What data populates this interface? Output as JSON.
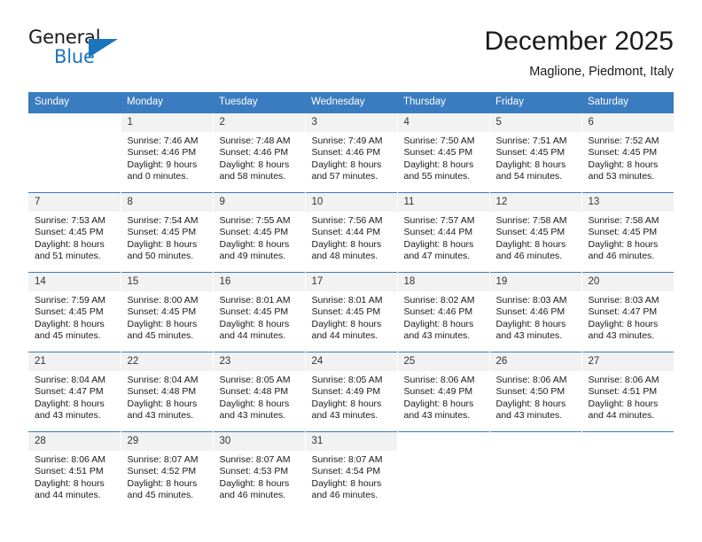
{
  "brand": {
    "name_top": "General",
    "name_bottom": "Blue",
    "accent_color": "#1b75bb"
  },
  "header": {
    "title": "December 2025",
    "subtitle": "Maglione, Piedmont, Italy"
  },
  "theme": {
    "header_row_bg": "#3a7cc0",
    "daynum_bg": "#f2f2f2",
    "page_bg": "#ffffff"
  },
  "columns": [
    "Sunday",
    "Monday",
    "Tuesday",
    "Wednesday",
    "Thursday",
    "Friday",
    "Saturday"
  ],
  "weeks": [
    [
      {
        "day": "",
        "empty": true,
        "sunrise": "",
        "sunset": "",
        "daylight_line1": "",
        "daylight_line2": ""
      },
      {
        "day": "1",
        "sunrise": "Sunrise: 7:46 AM",
        "sunset": "Sunset: 4:46 PM",
        "daylight_line1": "Daylight: 9 hours",
        "daylight_line2": "and 0 minutes."
      },
      {
        "day": "2",
        "sunrise": "Sunrise: 7:48 AM",
        "sunset": "Sunset: 4:46 PM",
        "daylight_line1": "Daylight: 8 hours",
        "daylight_line2": "and 58 minutes."
      },
      {
        "day": "3",
        "sunrise": "Sunrise: 7:49 AM",
        "sunset": "Sunset: 4:46 PM",
        "daylight_line1": "Daylight: 8 hours",
        "daylight_line2": "and 57 minutes."
      },
      {
        "day": "4",
        "sunrise": "Sunrise: 7:50 AM",
        "sunset": "Sunset: 4:45 PM",
        "daylight_line1": "Daylight: 8 hours",
        "daylight_line2": "and 55 minutes."
      },
      {
        "day": "5",
        "sunrise": "Sunrise: 7:51 AM",
        "sunset": "Sunset: 4:45 PM",
        "daylight_line1": "Daylight: 8 hours",
        "daylight_line2": "and 54 minutes."
      },
      {
        "day": "6",
        "sunrise": "Sunrise: 7:52 AM",
        "sunset": "Sunset: 4:45 PM",
        "daylight_line1": "Daylight: 8 hours",
        "daylight_line2": "and 53 minutes."
      }
    ],
    [
      {
        "day": "7",
        "sunrise": "Sunrise: 7:53 AM",
        "sunset": "Sunset: 4:45 PM",
        "daylight_line1": "Daylight: 8 hours",
        "daylight_line2": "and 51 minutes."
      },
      {
        "day": "8",
        "sunrise": "Sunrise: 7:54 AM",
        "sunset": "Sunset: 4:45 PM",
        "daylight_line1": "Daylight: 8 hours",
        "daylight_line2": "and 50 minutes."
      },
      {
        "day": "9",
        "sunrise": "Sunrise: 7:55 AM",
        "sunset": "Sunset: 4:45 PM",
        "daylight_line1": "Daylight: 8 hours",
        "daylight_line2": "and 49 minutes."
      },
      {
        "day": "10",
        "sunrise": "Sunrise: 7:56 AM",
        "sunset": "Sunset: 4:44 PM",
        "daylight_line1": "Daylight: 8 hours",
        "daylight_line2": "and 48 minutes."
      },
      {
        "day": "11",
        "sunrise": "Sunrise: 7:57 AM",
        "sunset": "Sunset: 4:44 PM",
        "daylight_line1": "Daylight: 8 hours",
        "daylight_line2": "and 47 minutes."
      },
      {
        "day": "12",
        "sunrise": "Sunrise: 7:58 AM",
        "sunset": "Sunset: 4:45 PM",
        "daylight_line1": "Daylight: 8 hours",
        "daylight_line2": "and 46 minutes."
      },
      {
        "day": "13",
        "sunrise": "Sunrise: 7:58 AM",
        "sunset": "Sunset: 4:45 PM",
        "daylight_line1": "Daylight: 8 hours",
        "daylight_line2": "and 46 minutes."
      }
    ],
    [
      {
        "day": "14",
        "sunrise": "Sunrise: 7:59 AM",
        "sunset": "Sunset: 4:45 PM",
        "daylight_line1": "Daylight: 8 hours",
        "daylight_line2": "and 45 minutes."
      },
      {
        "day": "15",
        "sunrise": "Sunrise: 8:00 AM",
        "sunset": "Sunset: 4:45 PM",
        "daylight_line1": "Daylight: 8 hours",
        "daylight_line2": "and 45 minutes."
      },
      {
        "day": "16",
        "sunrise": "Sunrise: 8:01 AM",
        "sunset": "Sunset: 4:45 PM",
        "daylight_line1": "Daylight: 8 hours",
        "daylight_line2": "and 44 minutes."
      },
      {
        "day": "17",
        "sunrise": "Sunrise: 8:01 AM",
        "sunset": "Sunset: 4:45 PM",
        "daylight_line1": "Daylight: 8 hours",
        "daylight_line2": "and 44 minutes."
      },
      {
        "day": "18",
        "sunrise": "Sunrise: 8:02 AM",
        "sunset": "Sunset: 4:46 PM",
        "daylight_line1": "Daylight: 8 hours",
        "daylight_line2": "and 43 minutes."
      },
      {
        "day": "19",
        "sunrise": "Sunrise: 8:03 AM",
        "sunset": "Sunset: 4:46 PM",
        "daylight_line1": "Daylight: 8 hours",
        "daylight_line2": "and 43 minutes."
      },
      {
        "day": "20",
        "sunrise": "Sunrise: 8:03 AM",
        "sunset": "Sunset: 4:47 PM",
        "daylight_line1": "Daylight: 8 hours",
        "daylight_line2": "and 43 minutes."
      }
    ],
    [
      {
        "day": "21",
        "sunrise": "Sunrise: 8:04 AM",
        "sunset": "Sunset: 4:47 PM",
        "daylight_line1": "Daylight: 8 hours",
        "daylight_line2": "and 43 minutes."
      },
      {
        "day": "22",
        "sunrise": "Sunrise: 8:04 AM",
        "sunset": "Sunset: 4:48 PM",
        "daylight_line1": "Daylight: 8 hours",
        "daylight_line2": "and 43 minutes."
      },
      {
        "day": "23",
        "sunrise": "Sunrise: 8:05 AM",
        "sunset": "Sunset: 4:48 PM",
        "daylight_line1": "Daylight: 8 hours",
        "daylight_line2": "and 43 minutes."
      },
      {
        "day": "24",
        "sunrise": "Sunrise: 8:05 AM",
        "sunset": "Sunset: 4:49 PM",
        "daylight_line1": "Daylight: 8 hours",
        "daylight_line2": "and 43 minutes."
      },
      {
        "day": "25",
        "sunrise": "Sunrise: 8:06 AM",
        "sunset": "Sunset: 4:49 PM",
        "daylight_line1": "Daylight: 8 hours",
        "daylight_line2": "and 43 minutes."
      },
      {
        "day": "26",
        "sunrise": "Sunrise: 8:06 AM",
        "sunset": "Sunset: 4:50 PM",
        "daylight_line1": "Daylight: 8 hours",
        "daylight_line2": "and 43 minutes."
      },
      {
        "day": "27",
        "sunrise": "Sunrise: 8:06 AM",
        "sunset": "Sunset: 4:51 PM",
        "daylight_line1": "Daylight: 8 hours",
        "daylight_line2": "and 44 minutes."
      }
    ],
    [
      {
        "day": "28",
        "sunrise": "Sunrise: 8:06 AM",
        "sunset": "Sunset: 4:51 PM",
        "daylight_line1": "Daylight: 8 hours",
        "daylight_line2": "and 44 minutes."
      },
      {
        "day": "29",
        "sunrise": "Sunrise: 8:07 AM",
        "sunset": "Sunset: 4:52 PM",
        "daylight_line1": "Daylight: 8 hours",
        "daylight_line2": "and 45 minutes."
      },
      {
        "day": "30",
        "sunrise": "Sunrise: 8:07 AM",
        "sunset": "Sunset: 4:53 PM",
        "daylight_line1": "Daylight: 8 hours",
        "daylight_line2": "and 46 minutes."
      },
      {
        "day": "31",
        "sunrise": "Sunrise: 8:07 AM",
        "sunset": "Sunset: 4:54 PM",
        "daylight_line1": "Daylight: 8 hours",
        "daylight_line2": "and 46 minutes."
      },
      {
        "day": "",
        "empty": true,
        "sunrise": "",
        "sunset": "",
        "daylight_line1": "",
        "daylight_line2": ""
      },
      {
        "day": "",
        "empty": true,
        "sunrise": "",
        "sunset": "",
        "daylight_line1": "",
        "daylight_line2": ""
      },
      {
        "day": "",
        "empty": true,
        "sunrise": "",
        "sunset": "",
        "daylight_line1": "",
        "daylight_line2": ""
      }
    ]
  ]
}
